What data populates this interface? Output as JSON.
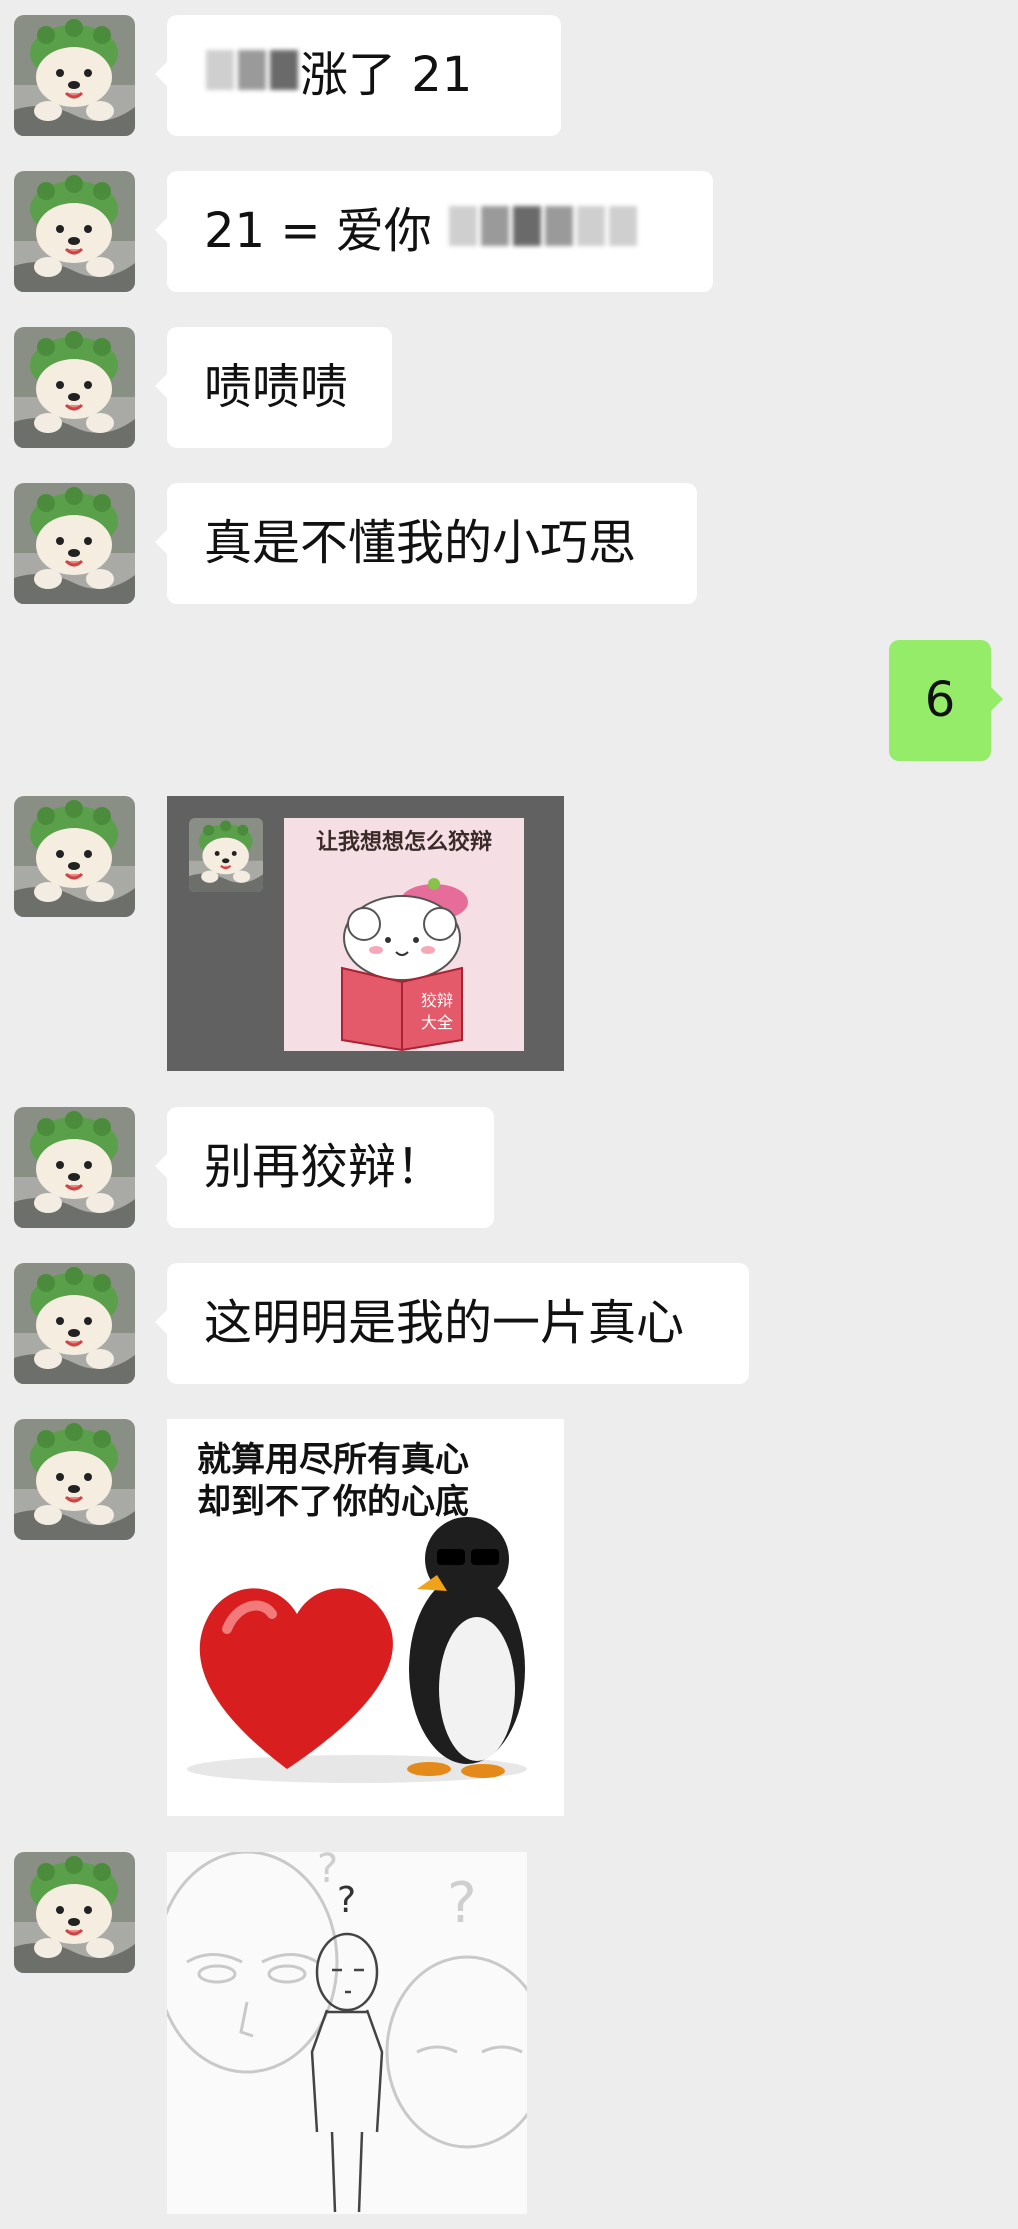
{
  "messages": [
    {
      "sender": "friend",
      "text_visible": "涨了 21",
      "redacted": true
    },
    {
      "sender": "friend",
      "text_visible": "21 = 爱你",
      "redacted": true
    },
    {
      "sender": "friend",
      "text": "啧啧啧"
    },
    {
      "sender": "friend",
      "text": "真是不懂我的小巧思"
    },
    {
      "sender": "me",
      "text": "6"
    },
    {
      "sender": "friend",
      "type": "sticker",
      "caption": "让我想想怎么狡辩",
      "book_text_line1": "狡辩",
      "book_text_line2": "大全"
    },
    {
      "sender": "friend",
      "text": "别再狡辩！"
    },
    {
      "sender": "friend",
      "text": "这明明是我的一片真心"
    },
    {
      "sender": "friend",
      "type": "sticker",
      "caption_line1": "就算用尽所有真心",
      "caption_line2": "却到不了你的心底"
    },
    {
      "sender": "friend",
      "type": "sticker",
      "description_icon": "confused-faces-sketch"
    }
  ],
  "colors": {
    "background": "#ededed",
    "incoming_bubble": "#ffffff",
    "outgoing_bubble": "#95ec69",
    "heart": "#d81e1e"
  }
}
